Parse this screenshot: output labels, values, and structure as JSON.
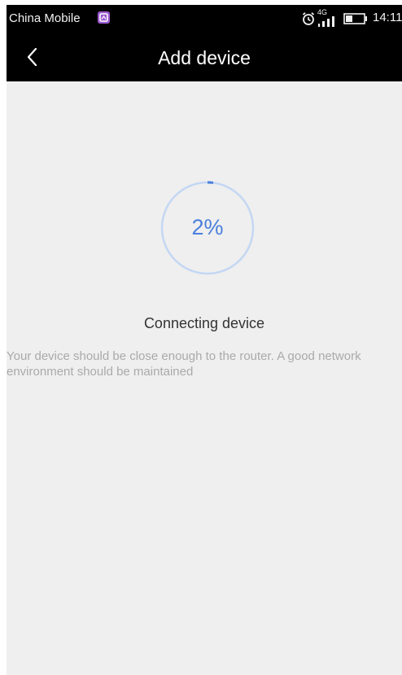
{
  "status_bar": {
    "carrier": "China Mobile",
    "network_label": "4G",
    "time": "14:11",
    "icons": [
      "carrier-badge-icon",
      "alarm-icon",
      "signal-icon",
      "battery-icon"
    ]
  },
  "nav": {
    "back_icon": "chevron-left-icon",
    "title": "Add device"
  },
  "progress": {
    "percent_label": "2%",
    "value": 0.02,
    "ring_color": "#c4d7f3",
    "accent_color": "#4a7fdc"
  },
  "connection": {
    "status": "Connecting device",
    "hint": "Your device should be close enough to the router. A good network environment should be maintained"
  },
  "colors": {
    "header_background": "#000000",
    "content_background": "#efefef",
    "status_text": "#333333",
    "hint_text": "#aaaaaa"
  }
}
